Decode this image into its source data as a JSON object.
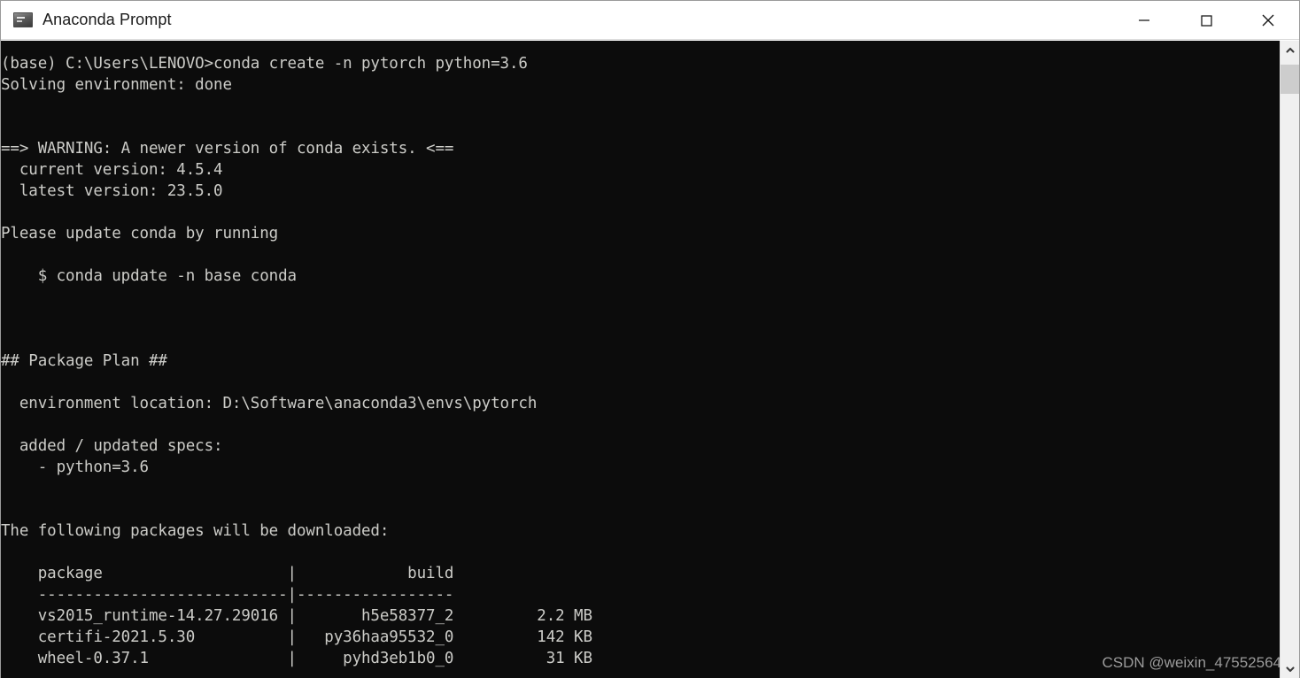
{
  "window": {
    "title": "Anaconda Prompt",
    "icon": "console-icon",
    "controls": {
      "minimize_label": "Minimize",
      "maximize_label": "Maximize",
      "close_label": "Close"
    }
  },
  "terminal": {
    "background_color": "#0c0c0c",
    "foreground_color": "#ccccc8",
    "prompt": "(base) C:\\Users\\LENOVO>",
    "command": "conda create -n pytorch python=3.6",
    "lines": [
      "(base) C:\\Users\\LENOVO>conda create -n pytorch python=3.6",
      "Solving environment: done",
      "",
      "",
      "==> WARNING: A newer version of conda exists. <==",
      "  current version: 4.5.4",
      "  latest version: 23.5.0",
      "",
      "Please update conda by running",
      "",
      "    $ conda update -n base conda",
      "",
      "",
      "",
      "## Package Plan ##",
      "",
      "  environment location: D:\\Software\\anaconda3\\envs\\pytorch",
      "",
      "  added / updated specs:",
      "    - python=3.6",
      "",
      "",
      "The following packages will be downloaded:",
      "",
      "    package                    |            build",
      "    ---------------------------|-----------------",
      "    vs2015_runtime-14.27.29016 |       h5e58377_2         2.2 MB",
      "    certifi-2021.5.30          |   py36haa95532_0         142 KB",
      "    wheel-0.37.1               |     pyhd3eb1b0_0          31 KB"
    ],
    "conda": {
      "current_version": "4.5.4",
      "latest_version": "23.5.0",
      "update_command": "$ conda update -n base conda",
      "environment_location": "D:\\Software\\anaconda3\\envs\\pytorch",
      "added_updated_specs": [
        "- python=3.6"
      ],
      "solving_environment_status": "done"
    },
    "package_table": {
      "headers": [
        "package",
        "build"
      ],
      "rows": [
        {
          "package": "vs2015_runtime-14.27.29016",
          "build": "h5e58377_2",
          "size": "2.2 MB"
        },
        {
          "package": "certifi-2021.5.30",
          "build": "py36haa95532_0",
          "size": "142 KB"
        },
        {
          "package": "wheel-0.37.1",
          "build": "pyhd3eb1b0_0",
          "size": "31 KB"
        }
      ]
    }
  },
  "watermark": {
    "text": "CSDN @weixin_47552564"
  },
  "scrollbar": {
    "up_arrow": "chevron-up-icon",
    "down_arrow": "chevron-down-icon",
    "thumb_position_percent": 4
  }
}
